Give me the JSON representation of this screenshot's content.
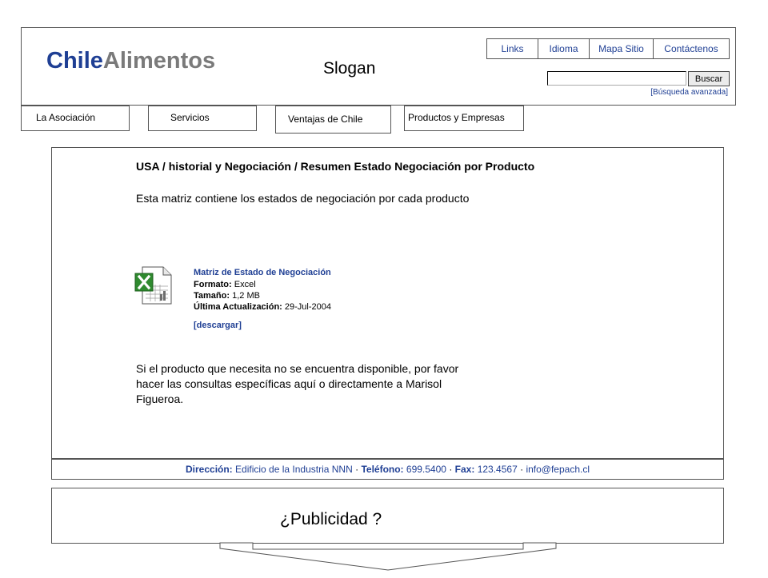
{
  "header": {
    "logo_part1": "Chile",
    "logo_part2": "Alimentos",
    "slogan": "Slogan",
    "top_links": [
      "Links",
      "Idioma",
      "Mapa Sitio",
      "Contáctenos"
    ],
    "search": {
      "value": "",
      "button_label": "Buscar",
      "advanced_label": "[Búsqueda avanzada]"
    }
  },
  "nav": {
    "tabs": [
      "La Asociación",
      "Servicios",
      "Ventajas de Chile",
      "Productos y Empresas"
    ]
  },
  "main": {
    "breadcrumb": "USA / historial y Negociación / Resumen Estado Negociación por Producto",
    "intro": "Esta matriz contiene los estados de negociación por cada producto",
    "document": {
      "title": "Matriz de Estado de Negociación",
      "format_label": "Formato:",
      "format_value": "Excel",
      "size_label": "Tamaño:",
      "size_value": "1,2 MB",
      "date_label": "Última Actualización:",
      "date_value": "29-Jul-2004",
      "download_label": "[descargar]",
      "icon": "excel-icon"
    },
    "note": "Si el producto que necesita no se encuentra disponible, por favor hacer las consultas específicas aquí o directamente a Marisol Figueroa."
  },
  "footer": {
    "address_label": "Dirección:",
    "address_value": "Edificio de la Industria NNN",
    "phone_label": "Teléfono:",
    "phone_value": "699.5400",
    "fax_label": "Fax:",
    "fax_value": "123.4567",
    "email": "info@fepach.cl"
  },
  "ad": {
    "text": "¿Publicidad ?"
  },
  "colors": {
    "link": "#1f3f94",
    "logo_gray": "#7a7a7a",
    "border": "#555555"
  }
}
